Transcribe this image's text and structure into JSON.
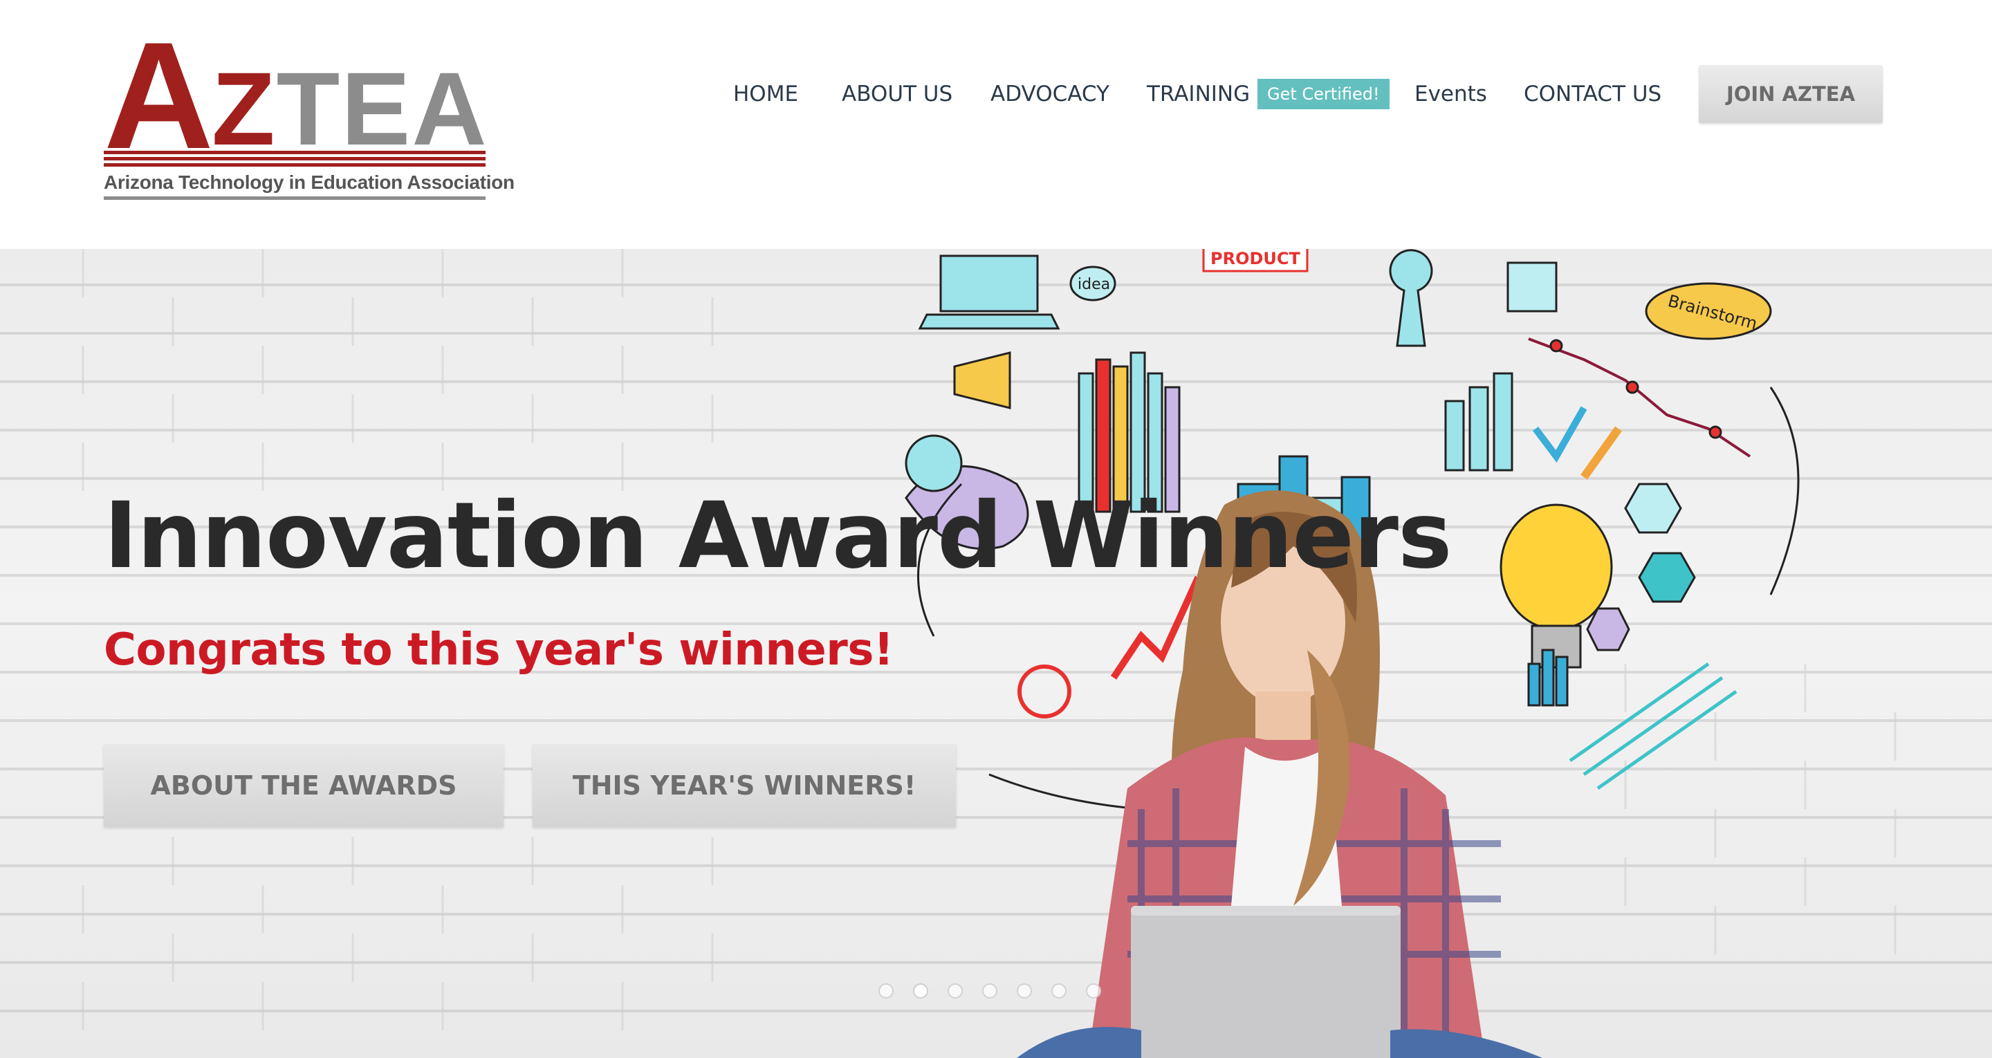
{
  "header": {
    "logo": {
      "letter_a": "A",
      "letters_rest_z": "Z",
      "letters_rest": "TEA",
      "tagline": "Arizona Technology in Education Association"
    },
    "nav": {
      "home": "HOME",
      "about": "ABOUT US",
      "advocacy": "ADVOCACY",
      "training": "TRAINING",
      "training_badge": "Get Certified!",
      "events": "Events",
      "contact": "CONTACT US"
    },
    "join_button": "JOIN AZTEA"
  },
  "hero": {
    "title": "Innovation Award Winners",
    "subtitle": "Congrats to this year's winners!",
    "buttons": {
      "about_awards": "ABOUT THE AWARDS",
      "winners": "THIS YEAR'S WINNERS!"
    },
    "doodle_labels": {
      "idea": "idea",
      "brainstorm": "Brainstorm",
      "product": "PRODUCT"
    },
    "slider": {
      "slide_count": 7,
      "active_index": 1
    }
  },
  "colors": {
    "brand_red": "#a0201d",
    "brand_gray": "#8c8c8c",
    "subtitle_red": "#cc1a25",
    "badge_teal": "#63c0bf",
    "nav_text": "#2b3a4a"
  }
}
